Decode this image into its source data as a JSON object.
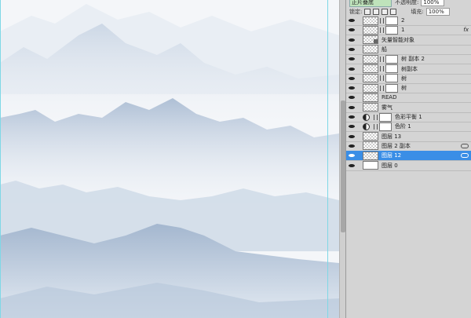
{
  "panel": {
    "blend_mode": "正片叠底",
    "opacity_label": "不透明度:",
    "opacity_value": "100%",
    "lock_label": "锁定:",
    "fill_label": "填充:",
    "fill_value": "100%"
  },
  "layers": [
    {
      "name": "2",
      "visible": true,
      "thumb": "checker",
      "mask": true,
      "fx": false,
      "link": false,
      "adjustment": false,
      "selected": false
    },
    {
      "name": "1",
      "visible": true,
      "thumb": "checker",
      "mask": true,
      "fx": true,
      "fx_label": "fx",
      "link": false,
      "adjustment": false,
      "selected": false
    },
    {
      "name": "矢量智能对象",
      "visible": true,
      "thumb": "smart",
      "mask": false,
      "fx": false,
      "link": false,
      "adjustment": false,
      "selected": false
    },
    {
      "name": "船",
      "visible": true,
      "thumb": "checker",
      "mask": false,
      "fx": false,
      "link": false,
      "adjustment": false,
      "selected": false
    },
    {
      "name": "树 副本 2",
      "visible": true,
      "thumb": "checker",
      "mask": true,
      "fx": false,
      "link": false,
      "adjustment": false,
      "selected": false
    },
    {
      "name": "树副本",
      "visible": true,
      "thumb": "checker",
      "mask": true,
      "fx": false,
      "link": false,
      "adjustment": false,
      "selected": false
    },
    {
      "name": "树",
      "visible": true,
      "thumb": "checker",
      "mask": true,
      "fx": false,
      "link": false,
      "adjustment": false,
      "selected": false
    },
    {
      "name": "树",
      "visible": true,
      "thumb": "checker",
      "mask": true,
      "fx": false,
      "link": false,
      "adjustment": false,
      "selected": false
    },
    {
      "name": "READ",
      "visible": true,
      "thumb": "checker",
      "mask": false,
      "fx": false,
      "link": false,
      "adjustment": false,
      "selected": false
    },
    {
      "name": "雾气",
      "visible": true,
      "thumb": "checker",
      "mask": false,
      "fx": false,
      "link": false,
      "adjustment": false,
      "selected": false
    },
    {
      "name": "色彩平衡 1",
      "visible": true,
      "thumb": "white",
      "mask": true,
      "fx": false,
      "link": false,
      "adjustment": true,
      "selected": false
    },
    {
      "name": "色阶 1",
      "visible": true,
      "thumb": "white",
      "mask": true,
      "fx": false,
      "link": false,
      "adjustment": true,
      "selected": false
    },
    {
      "name": "图层 13",
      "visible": true,
      "thumb": "checker",
      "mask": false,
      "fx": false,
      "link": false,
      "adjustment": false,
      "selected": false
    },
    {
      "name": "图层 2 副本",
      "visible": true,
      "thumb": "checker",
      "mask": false,
      "fx": false,
      "link": true,
      "adjustment": false,
      "selected": false
    },
    {
      "name": "图层 12",
      "visible": true,
      "thumb": "checker",
      "mask": false,
      "fx": false,
      "link": true,
      "adjustment": false,
      "selected": true
    },
    {
      "name": "图层 0",
      "visible": true,
      "thumb": "white",
      "mask": false,
      "fx": false,
      "link": false,
      "adjustment": false,
      "selected": false
    }
  ],
  "colors": {
    "canvas_bg": "#f4f6f9",
    "mountain_far": "#dbe4ee",
    "mountain_mid": "#c3d1e2",
    "mountain_near": "#aebfd5",
    "selection": "#3a8ee6",
    "guide": "#7fd8e6"
  }
}
